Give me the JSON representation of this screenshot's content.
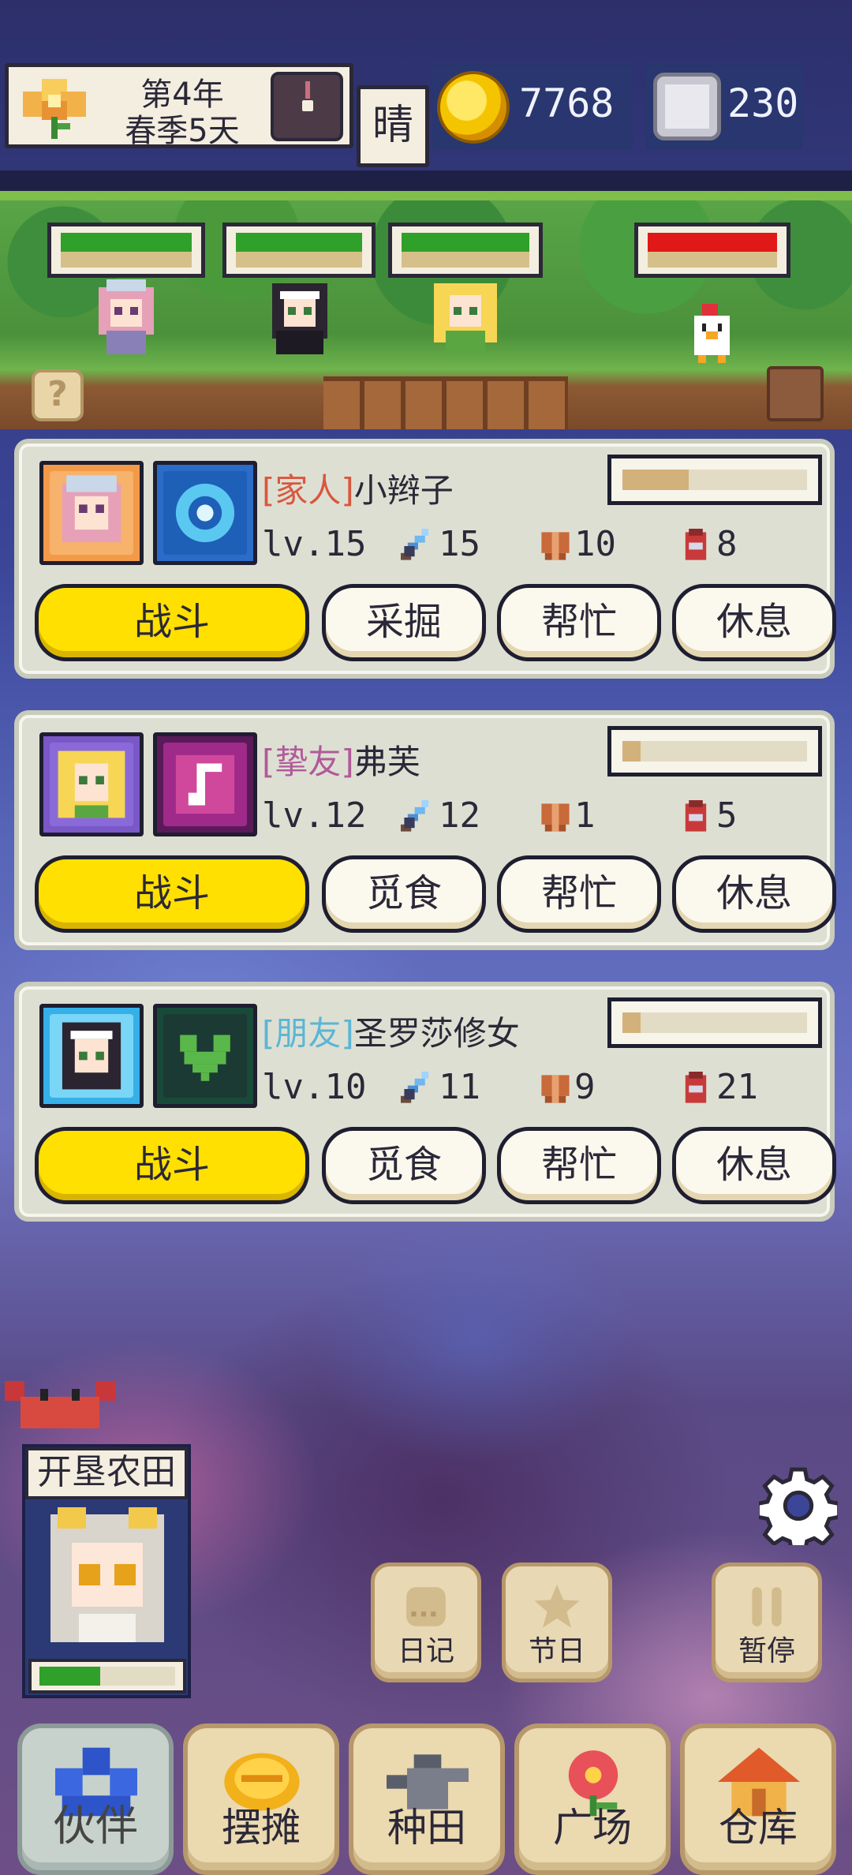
{
  "hud": {
    "date_line1": "第4年",
    "date_line2": "春季5天",
    "weather": "晴",
    "coins": "7768",
    "gems": "230",
    "icons": [
      "flower-icon",
      "clock-icon",
      "coin-icon",
      "gem-icon"
    ]
  },
  "scene": {
    "hp_bars": [
      {
        "fill": 1.0,
        "color": "#2fa02a"
      },
      {
        "fill": 1.0,
        "color": "#2fa02a"
      },
      {
        "fill": 1.0,
        "color": "#2fa02a"
      },
      {
        "fill": 1.0,
        "color": "#e01818"
      }
    ],
    "help_label": "?"
  },
  "companions": [
    {
      "relation": "[家人]",
      "relation_color": "#d8573f",
      "name": "小辫子",
      "level": "lv.15",
      "attack": "15",
      "defense": "10",
      "stamina": "8",
      "xp": 0.36,
      "actions": [
        "战斗",
        "采掘",
        "帮忙",
        "休息"
      ]
    },
    {
      "relation": "[挚友]",
      "relation_color": "#b05a9a",
      "name": "弗芙",
      "level": "lv.12",
      "attack": "12",
      "defense": "1",
      "stamina": "5",
      "xp": 0.1,
      "actions": [
        "战斗",
        "觅食",
        "帮忙",
        "休息"
      ]
    },
    {
      "relation": "[朋友]",
      "relation_color": "#5ab6d4",
      "name": "圣罗莎修女",
      "level": "lv.10",
      "attack": "11",
      "defense": "9",
      "stamina": "21",
      "xp": 0.1,
      "actions": [
        "战斗",
        "觅食",
        "帮忙",
        "休息"
      ]
    }
  ],
  "farm": {
    "label": "开垦农田",
    "progress": 0.45
  },
  "side_buttons": [
    {
      "label": "日记",
      "icon": "diary-icon"
    },
    {
      "label": "节日",
      "icon": "star-icon"
    },
    {
      "label": "暂停",
      "icon": "pause-icon"
    }
  ],
  "nav": [
    {
      "label": "伙伴",
      "icon": "companions-icon",
      "active": true
    },
    {
      "label": "摆摊",
      "icon": "stall-icon",
      "active": false
    },
    {
      "label": "种田",
      "icon": "watering-can-icon",
      "active": false
    },
    {
      "label": "广场",
      "icon": "flower-icon",
      "active": false
    },
    {
      "label": "仓库",
      "icon": "house-icon",
      "active": false
    }
  ]
}
